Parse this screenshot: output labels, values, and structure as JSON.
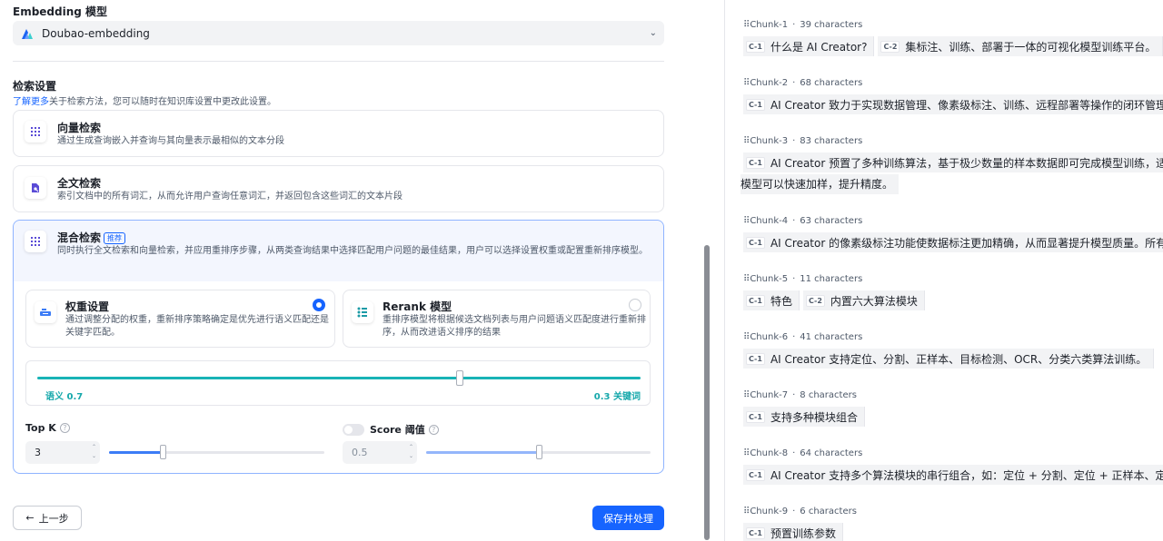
{
  "embedding": {
    "title": "Embedding 模型",
    "model": "Doubao-embedding"
  },
  "retrieval": {
    "title": "检索设置",
    "learn_more": "了解更多",
    "hint": "关于检索方法，您可以随时在知识库设置中更改此设置。",
    "vector": {
      "title": "向量检索",
      "desc": "通过生成查询嵌入并查询与其向量表示最相似的文本分段"
    },
    "fulltext": {
      "title": "全文检索",
      "desc": "索引文档中的所有词汇，从而允许用户查询任意词汇，并返回包含这些词汇的文本片段"
    },
    "hybrid": {
      "title": "混合检索",
      "tag": "推荐",
      "desc": "同时执行全文检索和向量检索，并应用重排序步骤，从两类查询结果中选择匹配用户问题的最佳结果，用户可以选择设置权重或配置重新排序模型。",
      "weight": {
        "title": "权重设置",
        "desc": "通过调整分配的权重，重新排序策略确定是优先进行语义匹配还是关键字匹配。",
        "selected": true
      },
      "rerank": {
        "title": "Rerank 模型",
        "desc": "重排序模型将根据候选文档列表与用户问题语义匹配度进行重新排序，从而改进语义排序的结果",
        "selected": false
      },
      "semantic_label": "语义 0.7",
      "keyword_label": "0.3 关键词",
      "semantic_weight": 0.7
    },
    "topk": {
      "label": "Top K",
      "help": "?",
      "value": "3",
      "slider_fraction": 0.25
    },
    "score": {
      "label": "Score 阈值",
      "help": "?",
      "enabled": false,
      "value": "0.5",
      "slider_fraction": 0.5
    }
  },
  "footer": {
    "prev_arrow": "←",
    "prev": "上一步",
    "save": "保存并处理"
  },
  "chunks": [
    {
      "name": "Chunk-1",
      "chars": "39 characters",
      "segments": [
        {
          "badge": "C-1",
          "text": "什么是 AI Creator?"
        },
        {
          "badge": "C-2",
          "text": "集标注、训练、部署于一体的可视化模型训练平台。"
        }
      ]
    },
    {
      "name": "Chunk-2",
      "chars": "68 characters",
      "segments": [
        {
          "badge": "C-1",
          "text": "AI Creator 致力于实现数据管理、像素级标注、训练、远程部署等操作的闭环管理，"
        }
      ]
    },
    {
      "name": "Chunk-3",
      "chars": "83 characters",
      "segments": [
        {
          "badge": "C-1",
          "text": "AI Creator 预置了多种训练算法，基于极少数量的样本数据即可完成模型训练，适用"
        }
      ],
      "continuation": "模型可以快速加样，提升精度。"
    },
    {
      "name": "Chunk-4",
      "chars": "63 characters",
      "segments": [
        {
          "badge": "C-1",
          "text": "AI Creator 的像素级标注功能使数据标注更加精确，从而显著提升模型质量。所有操"
        }
      ]
    },
    {
      "name": "Chunk-5",
      "chars": "11 characters",
      "segments": [
        {
          "badge": "C-1",
          "text": "特色"
        },
        {
          "badge": "C-2",
          "text": "内置六大算法模块"
        }
      ]
    },
    {
      "name": "Chunk-6",
      "chars": "41 characters",
      "segments": [
        {
          "badge": "C-1",
          "text": "AI Creator 支持定位、分割、正样本、目标检测、OCR、分类六类算法训练。"
        }
      ]
    },
    {
      "name": "Chunk-7",
      "chars": "8 characters",
      "segments": [
        {
          "badge": "C-1",
          "text": "支持多种模块组合"
        }
      ]
    },
    {
      "name": "Chunk-8",
      "chars": "64 characters",
      "segments": [
        {
          "badge": "C-1",
          "text": "AI Creator 支持多个算法模块的串行组合，如：定位 + 分割、定位 + 正样本、定位"
        }
      ]
    },
    {
      "name": "Chunk-9",
      "chars": "6 characters",
      "segments": [
        {
          "badge": "C-1",
          "text": "预置训练参数"
        }
      ]
    }
  ],
  "chunk_separator": "·",
  "grip_glyph": "⠿",
  "colors": {
    "primary": "#1664ff",
    "weight_track": "#18b3b6",
    "active_card_bg": "#f3f6fe"
  }
}
